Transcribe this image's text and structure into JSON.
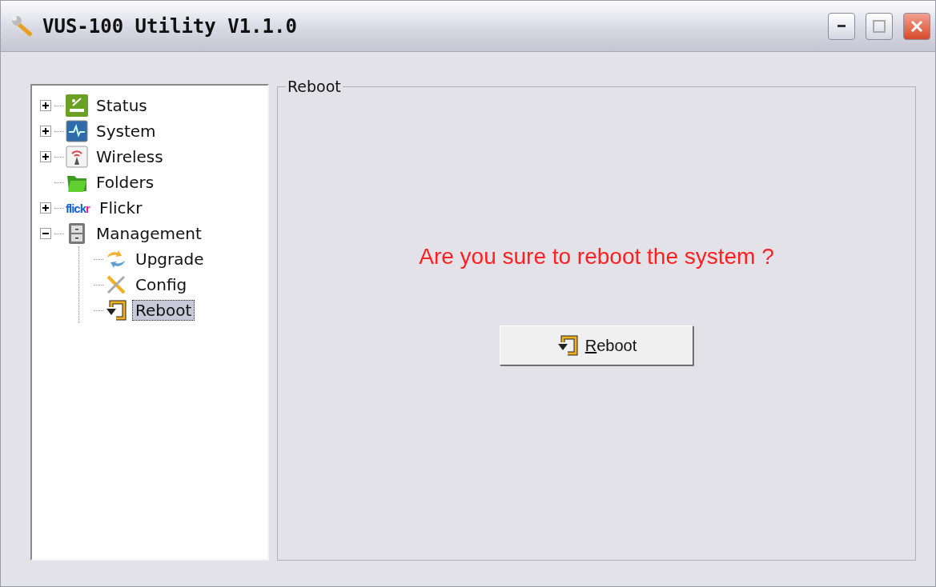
{
  "window": {
    "title": "VUS-100 Utility V1.1.0"
  },
  "tree": [
    {
      "label": "Status",
      "kind": "status",
      "expanded": false,
      "selected": false
    },
    {
      "label": "System",
      "kind": "system",
      "expanded": false,
      "selected": false
    },
    {
      "label": "Wireless",
      "kind": "wireless",
      "expanded": false,
      "selected": false
    },
    {
      "label": "Folders",
      "kind": "folder",
      "selected": false
    },
    {
      "label": "Flickr",
      "kind": "logo",
      "icon_text": "flickr",
      "expanded": false,
      "selected": false
    },
    {
      "label": "Management",
      "kind": "cabinet",
      "expanded": true,
      "selected": false,
      "children": [
        {
          "label": "Upgrade",
          "kind": "upgrade",
          "selected": false
        },
        {
          "label": "Config",
          "kind": "tools",
          "selected": false
        },
        {
          "label": "Reboot",
          "kind": "reboot",
          "selected": true
        }
      ]
    }
  ],
  "panel": {
    "title": "Reboot",
    "message": "Are you sure to reboot the system ?",
    "button": "Reboot"
  }
}
